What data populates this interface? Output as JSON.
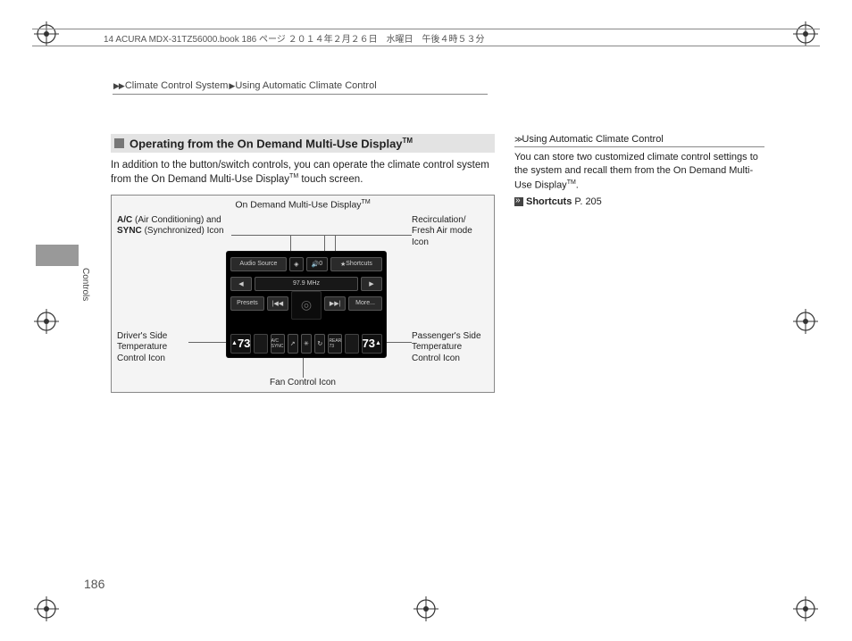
{
  "header": "14 ACURA MDX-31TZ56000.book  186 ページ  ２０１４年２月２６日　水曜日　午後４時５３分",
  "breadcrumb": {
    "a": "Climate Control System",
    "b": "Using Automatic Climate Control"
  },
  "side_label": "Controls",
  "heading": "Operating from the On Demand Multi-Use Display",
  "heading_tm": "TM",
  "intro": "In addition to the button/switch controls, you can operate the climate control system from the On Demand Multi-Use Display",
  "intro_suffix": " touch screen.",
  "figure": {
    "title": "On Demand Multi-Use Display",
    "title_tm": "TM",
    "callouts": {
      "ac_sync_1": "A/C",
      "ac_sync_2": " (Air Conditioning) and ",
      "ac_sync_3": "SYNC",
      "ac_sync_4": " (Synchronized) Icon",
      "recirc": "Recirculation/ Fresh Air mode Icon",
      "driver": "Driver's Side Temperature Control Icon",
      "passenger": "Passenger's Side Temperature Control Icon",
      "fan": "Fan Control Icon"
    },
    "device": {
      "audio_source": "Audio Source",
      "vol": "0",
      "shortcuts": "Shortcuts",
      "freq": "97.9 MHz",
      "presets": "Presets",
      "more": "More...",
      "temp_left": "73",
      "temp_right": "73"
    }
  },
  "sidebar": {
    "head": "Using Automatic Climate Control",
    "body": "You can store two customized climate control settings to the system and recall them from the On Demand Multi-Use Display",
    "body_tm": "TM",
    "link_label": "Shortcuts",
    "link_page": "P. 205"
  },
  "page_number": "186"
}
